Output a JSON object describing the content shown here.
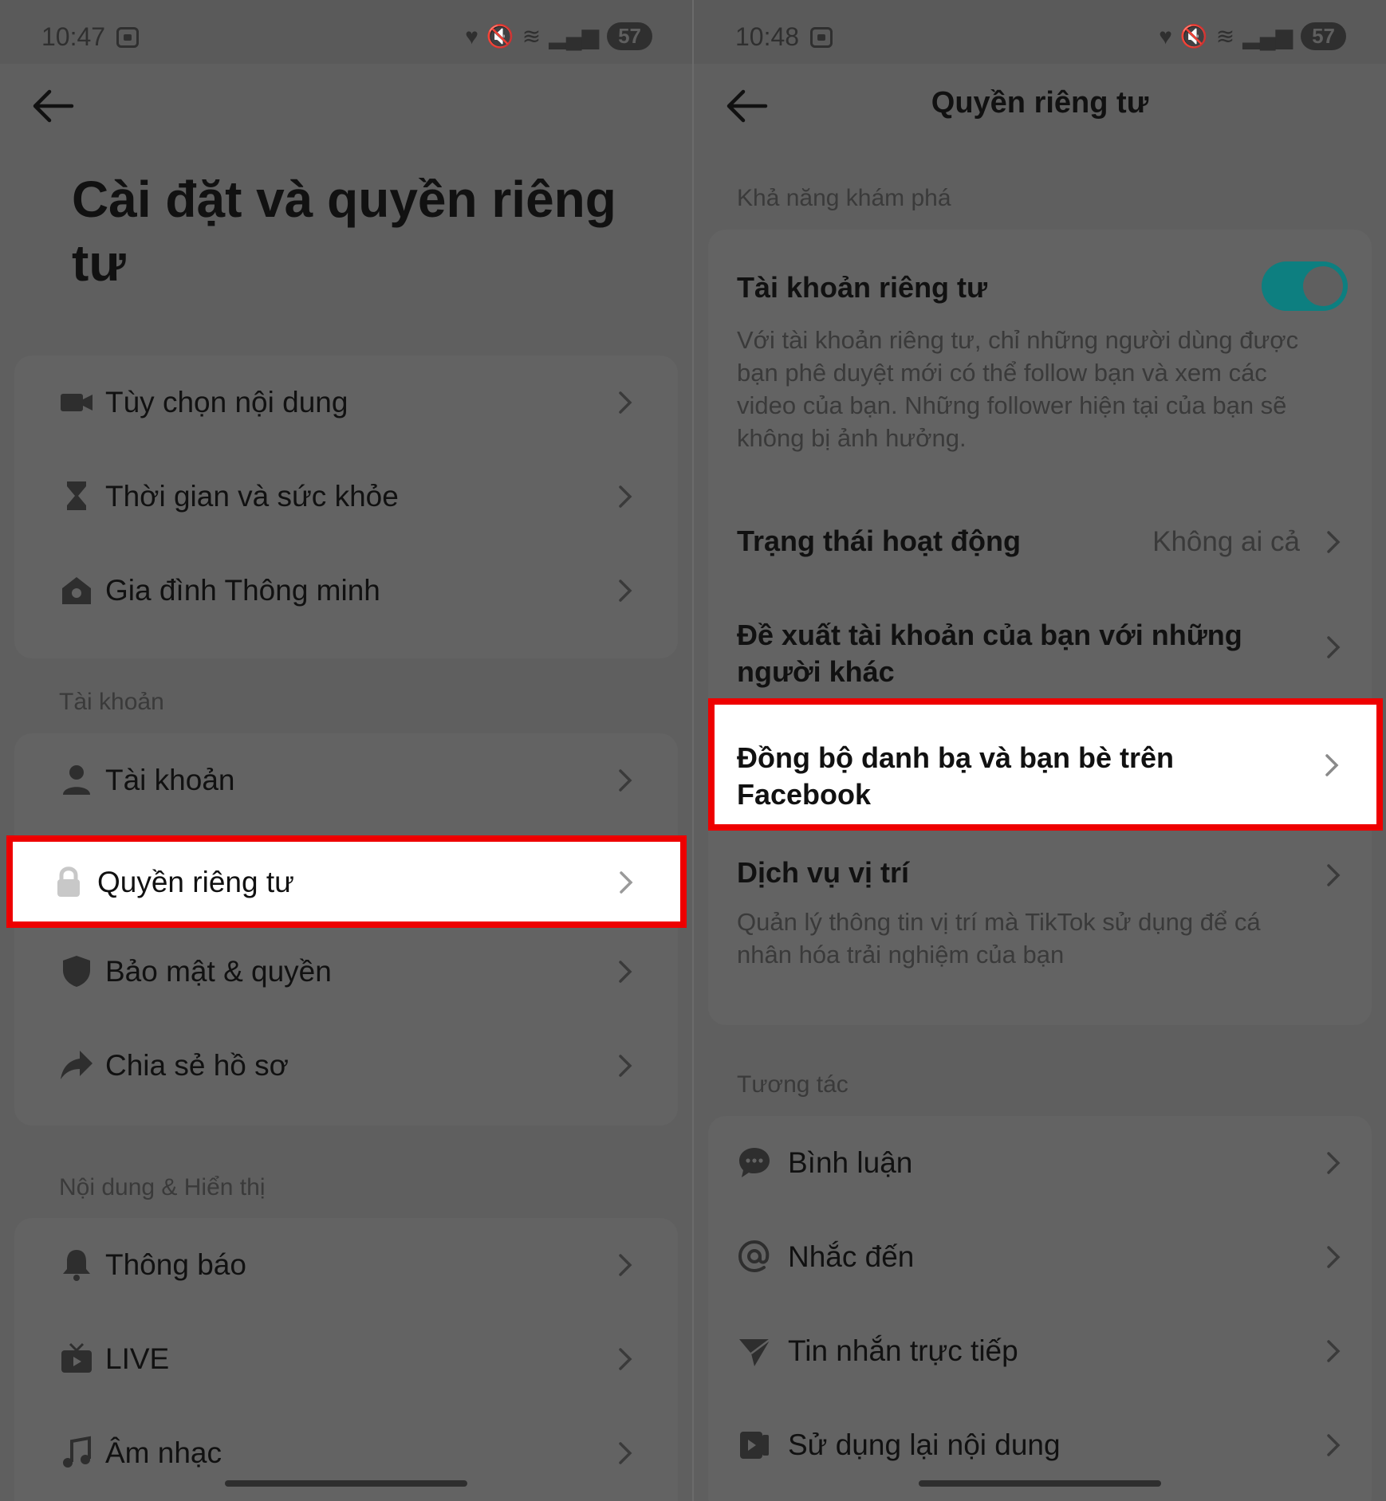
{
  "left": {
    "status": {
      "time": "10:47",
      "battery": "57"
    },
    "title": "Cài đặt và quyền riêng tư",
    "group1": [
      {
        "label": "Tùy chọn nội dung",
        "icon": "video-camera-icon"
      },
      {
        "label": "Thời gian và sức khỏe",
        "icon": "hourglass-icon"
      },
      {
        "label": "Gia đình Thông minh",
        "icon": "home-icon"
      }
    ],
    "section_account": "Tài khoản",
    "group2": [
      {
        "label": "Tài khoản",
        "icon": "person-icon"
      },
      {
        "label": "Quyền riêng tư",
        "icon": "lock-icon",
        "highlighted": true
      },
      {
        "label": "Bảo mật & quyền",
        "icon": "shield-icon"
      },
      {
        "label": "Chia sẻ hồ sơ",
        "icon": "share-icon"
      }
    ],
    "section_content": "Nội dung & Hiển thị",
    "group3": [
      {
        "label": "Thông báo",
        "icon": "bell-icon"
      },
      {
        "label": "LIVE",
        "icon": "tv-icon"
      },
      {
        "label": "Âm nhạc",
        "icon": "music-note-icon"
      }
    ]
  },
  "right": {
    "status": {
      "time": "10:48",
      "battery": "57"
    },
    "title": "Quyền riêng tư",
    "section_discover": "Khả năng khám phá",
    "private_account": {
      "title": "Tài khoản riêng tư",
      "desc_lines": [
        "Với tài khoản riêng tư, chỉ những người dùng được",
        "bạn phê duyệt mới có thể follow bạn và xem các",
        "video của bạn. Những follower hiện tại của bạn sẽ",
        "không bị ảnh hưởng."
      ],
      "toggle_on": true
    },
    "activity_status": {
      "title": "Trạng thái hoạt động",
      "value": "Không ai cả"
    },
    "suggest_account": {
      "lines": [
        "Đề xuất tài khoản của bạn với những",
        "người khác"
      ]
    },
    "sync_contacts": {
      "lines": [
        "Đồng bộ danh bạ và bạn bè trên",
        "Facebook"
      ],
      "highlighted": true
    },
    "location": {
      "title": "Dịch vụ vị trí",
      "desc_lines": [
        "Quản lý thông tin vị trí mà TikTok sử dụng để cá",
        "nhân hóa trải nghiệm của bạn"
      ]
    },
    "section_interaction": "Tương tác",
    "interaction_items": [
      {
        "label": "Bình luận",
        "icon": "comment-icon"
      },
      {
        "label": "Nhắc đến",
        "icon": "at-sign-icon"
      },
      {
        "label": "Tin nhắn trực tiếp",
        "icon": "send-icon"
      },
      {
        "label": "Sử dụng lại nội dung",
        "icon": "reuse-content-icon"
      }
    ]
  },
  "colors": {
    "accent_toggle": "#0d7f80",
    "highlight_border": "#ee0000",
    "dim_background": "#5f5f5f"
  }
}
